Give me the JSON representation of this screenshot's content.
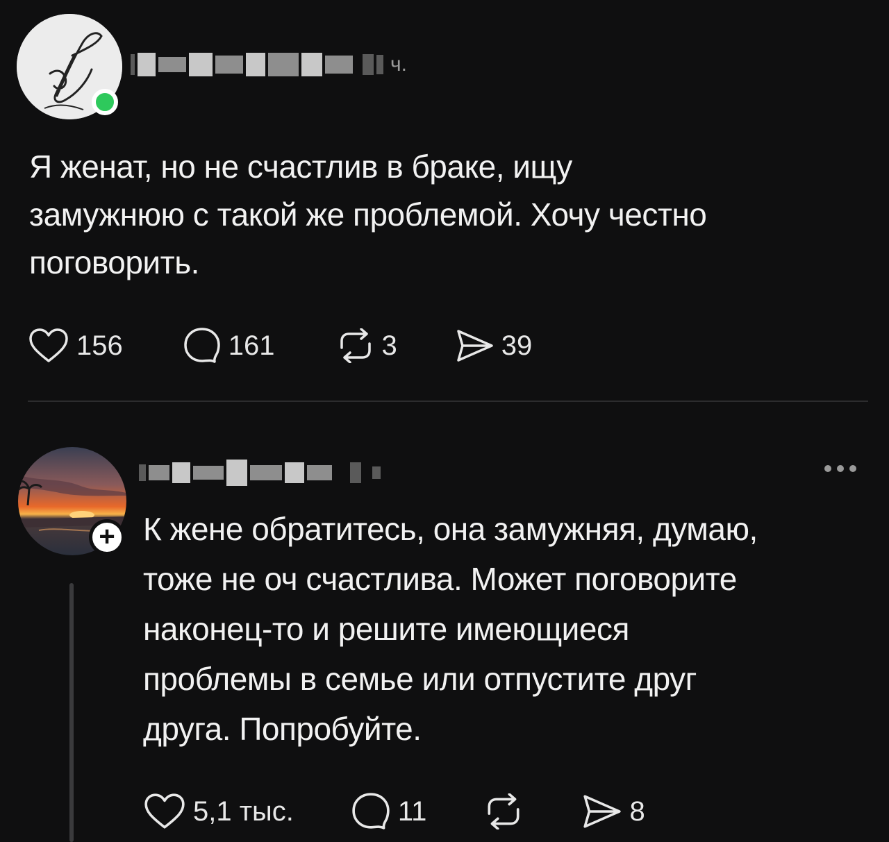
{
  "post": {
    "time_suffix": "ч.",
    "text": "Я женат, но не счастлив в браке, ищу\nзамужнюю с такой же проблемой. Хочу честно\nпоговорить.",
    "likes": "156",
    "comments": "161",
    "reposts": "3",
    "shares": "39"
  },
  "reply": {
    "text": "К жене обратитесь, она замужняя, думаю,\nтоже не оч счастлива. Может поговорите\nнаконец-то и решите имеющиеся\nпроблемы в семье или отпустите друг\nдруга. Попробуйте.",
    "likes": "5,1 тыс.",
    "comments": "11",
    "shares": "8"
  },
  "icons": {
    "like": "heart-icon",
    "comment": "comment-bubble-icon",
    "repost": "repost-icon",
    "share": "send-icon",
    "more": "more-dots-icon",
    "follow": "plus-icon"
  },
  "colors": {
    "background": "#0f0f10",
    "text": "#f2f2f2",
    "online": "#2ec95c"
  }
}
